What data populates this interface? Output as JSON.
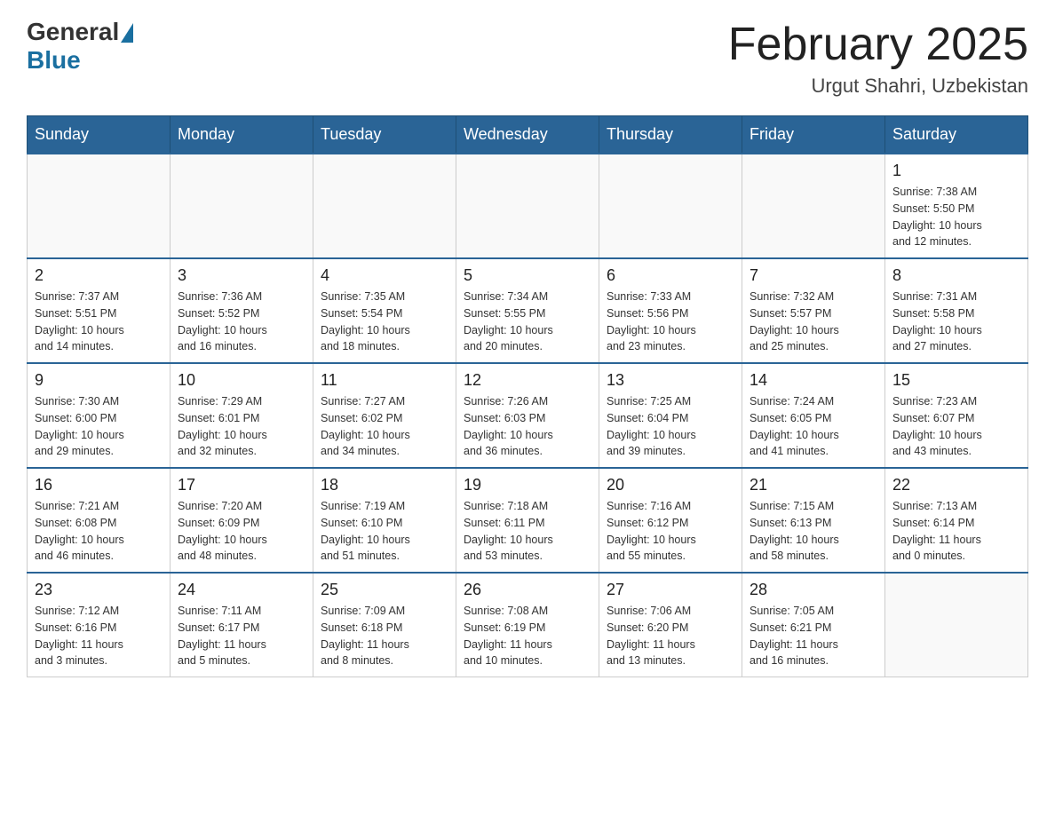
{
  "header": {
    "logo_general": "General",
    "logo_blue": "Blue",
    "month_title": "February 2025",
    "location": "Urgut Shahri, Uzbekistan"
  },
  "days_of_week": [
    "Sunday",
    "Monday",
    "Tuesday",
    "Wednesday",
    "Thursday",
    "Friday",
    "Saturday"
  ],
  "weeks": [
    {
      "days": [
        {
          "number": "",
          "info": ""
        },
        {
          "number": "",
          "info": ""
        },
        {
          "number": "",
          "info": ""
        },
        {
          "number": "",
          "info": ""
        },
        {
          "number": "",
          "info": ""
        },
        {
          "number": "",
          "info": ""
        },
        {
          "number": "1",
          "info": "Sunrise: 7:38 AM\nSunset: 5:50 PM\nDaylight: 10 hours\nand 12 minutes."
        }
      ]
    },
    {
      "days": [
        {
          "number": "2",
          "info": "Sunrise: 7:37 AM\nSunset: 5:51 PM\nDaylight: 10 hours\nand 14 minutes."
        },
        {
          "number": "3",
          "info": "Sunrise: 7:36 AM\nSunset: 5:52 PM\nDaylight: 10 hours\nand 16 minutes."
        },
        {
          "number": "4",
          "info": "Sunrise: 7:35 AM\nSunset: 5:54 PM\nDaylight: 10 hours\nand 18 minutes."
        },
        {
          "number": "5",
          "info": "Sunrise: 7:34 AM\nSunset: 5:55 PM\nDaylight: 10 hours\nand 20 minutes."
        },
        {
          "number": "6",
          "info": "Sunrise: 7:33 AM\nSunset: 5:56 PM\nDaylight: 10 hours\nand 23 minutes."
        },
        {
          "number": "7",
          "info": "Sunrise: 7:32 AM\nSunset: 5:57 PM\nDaylight: 10 hours\nand 25 minutes."
        },
        {
          "number": "8",
          "info": "Sunrise: 7:31 AM\nSunset: 5:58 PM\nDaylight: 10 hours\nand 27 minutes."
        }
      ]
    },
    {
      "days": [
        {
          "number": "9",
          "info": "Sunrise: 7:30 AM\nSunset: 6:00 PM\nDaylight: 10 hours\nand 29 minutes."
        },
        {
          "number": "10",
          "info": "Sunrise: 7:29 AM\nSunset: 6:01 PM\nDaylight: 10 hours\nand 32 minutes."
        },
        {
          "number": "11",
          "info": "Sunrise: 7:27 AM\nSunset: 6:02 PM\nDaylight: 10 hours\nand 34 minutes."
        },
        {
          "number": "12",
          "info": "Sunrise: 7:26 AM\nSunset: 6:03 PM\nDaylight: 10 hours\nand 36 minutes."
        },
        {
          "number": "13",
          "info": "Sunrise: 7:25 AM\nSunset: 6:04 PM\nDaylight: 10 hours\nand 39 minutes."
        },
        {
          "number": "14",
          "info": "Sunrise: 7:24 AM\nSunset: 6:05 PM\nDaylight: 10 hours\nand 41 minutes."
        },
        {
          "number": "15",
          "info": "Sunrise: 7:23 AM\nSunset: 6:07 PM\nDaylight: 10 hours\nand 43 minutes."
        }
      ]
    },
    {
      "days": [
        {
          "number": "16",
          "info": "Sunrise: 7:21 AM\nSunset: 6:08 PM\nDaylight: 10 hours\nand 46 minutes."
        },
        {
          "number": "17",
          "info": "Sunrise: 7:20 AM\nSunset: 6:09 PM\nDaylight: 10 hours\nand 48 minutes."
        },
        {
          "number": "18",
          "info": "Sunrise: 7:19 AM\nSunset: 6:10 PM\nDaylight: 10 hours\nand 51 minutes."
        },
        {
          "number": "19",
          "info": "Sunrise: 7:18 AM\nSunset: 6:11 PM\nDaylight: 10 hours\nand 53 minutes."
        },
        {
          "number": "20",
          "info": "Sunrise: 7:16 AM\nSunset: 6:12 PM\nDaylight: 10 hours\nand 55 minutes."
        },
        {
          "number": "21",
          "info": "Sunrise: 7:15 AM\nSunset: 6:13 PM\nDaylight: 10 hours\nand 58 minutes."
        },
        {
          "number": "22",
          "info": "Sunrise: 7:13 AM\nSunset: 6:14 PM\nDaylight: 11 hours\nand 0 minutes."
        }
      ]
    },
    {
      "days": [
        {
          "number": "23",
          "info": "Sunrise: 7:12 AM\nSunset: 6:16 PM\nDaylight: 11 hours\nand 3 minutes."
        },
        {
          "number": "24",
          "info": "Sunrise: 7:11 AM\nSunset: 6:17 PM\nDaylight: 11 hours\nand 5 minutes."
        },
        {
          "number": "25",
          "info": "Sunrise: 7:09 AM\nSunset: 6:18 PM\nDaylight: 11 hours\nand 8 minutes."
        },
        {
          "number": "26",
          "info": "Sunrise: 7:08 AM\nSunset: 6:19 PM\nDaylight: 11 hours\nand 10 minutes."
        },
        {
          "number": "27",
          "info": "Sunrise: 7:06 AM\nSunset: 6:20 PM\nDaylight: 11 hours\nand 13 minutes."
        },
        {
          "number": "28",
          "info": "Sunrise: 7:05 AM\nSunset: 6:21 PM\nDaylight: 11 hours\nand 16 minutes."
        },
        {
          "number": "",
          "info": ""
        }
      ]
    }
  ]
}
